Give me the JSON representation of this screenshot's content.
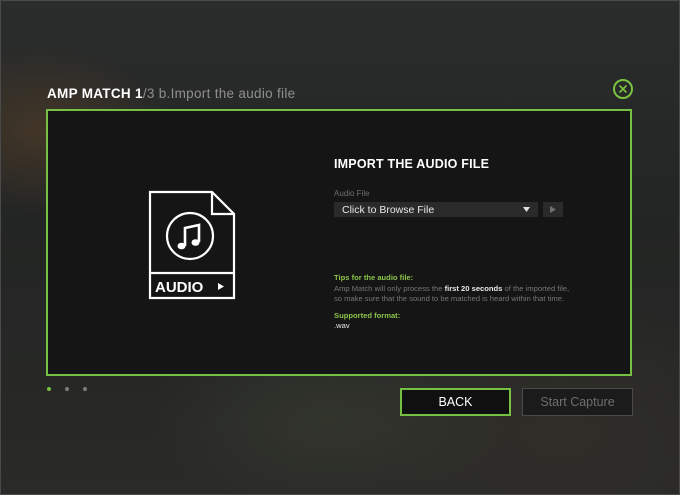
{
  "header": {
    "title_main": "AMP MATCH 1",
    "title_step": "/3 b.Import the audio file"
  },
  "close": {
    "icon": "close-icon",
    "color": "#7cc241"
  },
  "panel": {
    "icon_label": "AUDIO",
    "section_title": "IMPORT THE AUDIO FILE",
    "field_label": "Audio File",
    "select_value": "Click to Browse File",
    "tips_heading": "Tips for the audio file:",
    "tips_line1_pre": "Amp Match will only process the ",
    "tips_line1_hl": "first 20 seconds",
    "tips_line1_post": " of the imported file,",
    "tips_line2": "so make sure that the sound to be matched is heard within that time.",
    "format_heading": "Supported format:",
    "format_value": ".wav"
  },
  "pagination": {
    "count": 3,
    "current": 1
  },
  "buttons": {
    "back": "BACK",
    "start_capture": "Start Capture"
  },
  "colors": {
    "accent": "#76c043",
    "panel_bg": "#151515"
  }
}
